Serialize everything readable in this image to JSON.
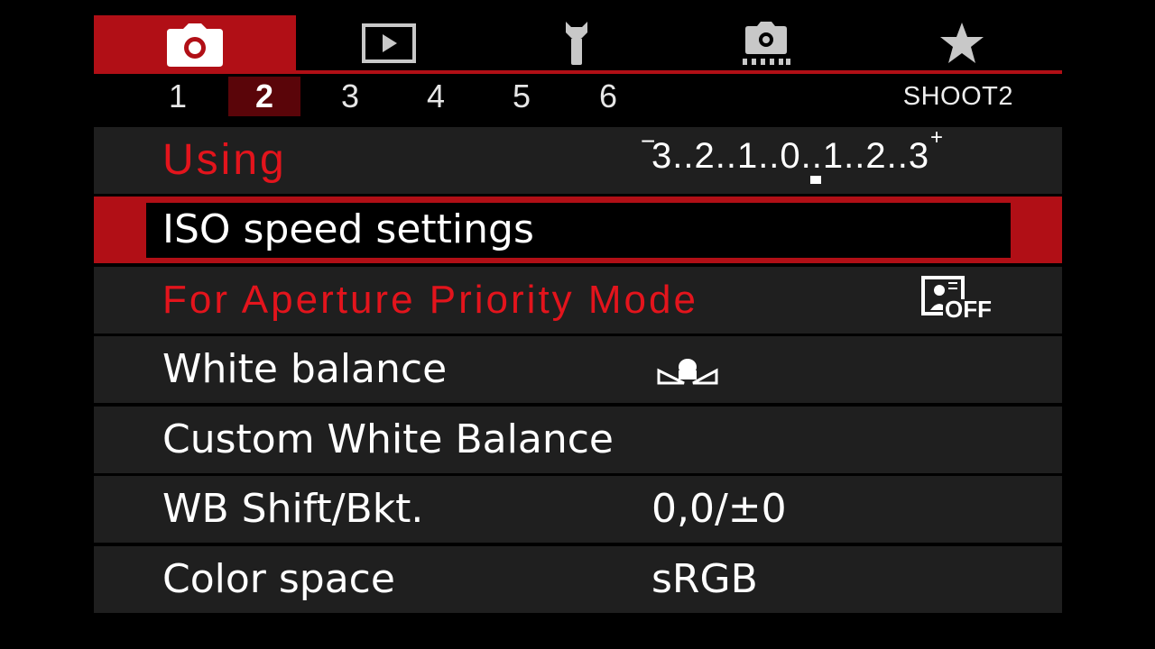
{
  "tabs": [
    {
      "icon": "camera-shoot-icon",
      "active": true
    },
    {
      "icon": "playback-icon",
      "active": false
    },
    {
      "icon": "wrench-setup-icon",
      "active": false
    },
    {
      "icon": "custom-function-camera-icon",
      "active": false
    },
    {
      "icon": "my-menu-star-icon",
      "active": false
    }
  ],
  "colors": {
    "accent": "#b10f16",
    "row_bg": "#1f1f1f",
    "overlay_red": "#e3141c",
    "subtab_active": "#5a0509"
  },
  "subtabs": [
    "1",
    "2",
    "3",
    "4",
    "5",
    "6"
  ],
  "active_subtab": "2",
  "page_id": "SHOOT2",
  "rows": {
    "overlay_top": "Using",
    "exposure_scale": {
      "minus": "−",
      "text": "3..2..1..0..1..2..3",
      "plus": "+",
      "current_value": 0
    },
    "iso": "ISO speed settings",
    "overlay_bottom": "For Aperture Priority Mode",
    "auto_lighting_icon": "auto-lighting-optimizer-off-icon",
    "auto_lighting_off_text": "OFF",
    "white_balance": {
      "label": "White balance",
      "icon": "white-balance-auto-icon"
    },
    "custom_wb": {
      "label": "Custom White Balance"
    },
    "wb_shift": {
      "label": "WB Shift/Bkt.",
      "value": "0,0/±0"
    },
    "color_space": {
      "label": "Color space",
      "value": "sRGB"
    }
  }
}
